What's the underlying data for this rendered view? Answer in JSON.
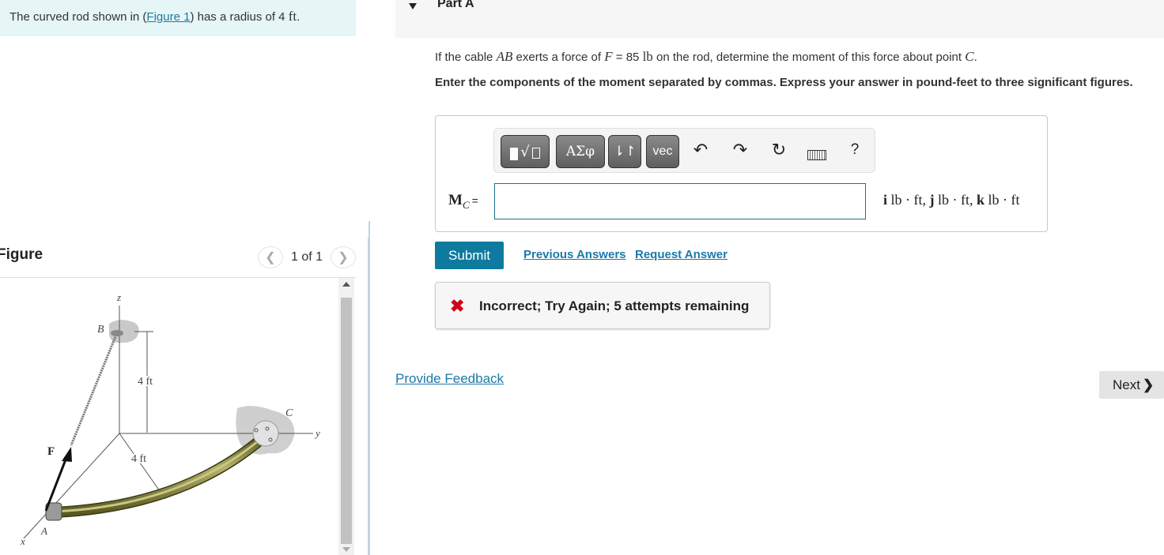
{
  "intro": {
    "text_before": "The curved rod shown in (",
    "figure_link": "Figure 1",
    "text_after": ") has a radius of 4 ",
    "unit": "ft",
    "period": "."
  },
  "figure_panel": {
    "title": "Figure",
    "pager": {
      "prev_icon": "chevron-left-icon",
      "text": "1 of 1",
      "next_icon": "chevron-right-icon"
    },
    "diagram_labels": {
      "z_axis": "z",
      "y_axis": "y",
      "x_axis": "x",
      "point_b": "B",
      "point_c": "C",
      "point_a": "A",
      "force": "F",
      "height_dim": "4 ft",
      "radius_dim": "4 ft"
    }
  },
  "part": {
    "title": "Part A",
    "question": {
      "t1": "If the cable ",
      "m1": "AB",
      "t2": " exerts a force of ",
      "m2": "F",
      "t3": " = 85 ",
      "m3": "lb",
      "t4": " on the rod, determine the moment of this force about point ",
      "m4": "C",
      "t5": "."
    },
    "instructions": "Enter the components of the moment separated by commas. Express your answer in pound-feet to three significant figures.",
    "toolbar": {
      "templates_icon": "templates-icon",
      "greek_label": "ΑΣφ",
      "arrows_label": "⇂↾",
      "vec_label": "vec",
      "undo_icon": "undo-icon",
      "redo_icon": "redo-icon",
      "reset_icon": "reset-icon",
      "keyboard_icon": "keyboard-icon",
      "help_label": "?"
    },
    "answer": {
      "label_main": "M",
      "label_sub": "C",
      "equals": "=",
      "value": "",
      "units": {
        "i": "i",
        "i_unit": " lb · ft, ",
        "j": "j",
        "j_unit": " lb · ft, ",
        "k": "k",
        "k_unit": " lb · ft"
      }
    },
    "submit_label": "Submit",
    "previous_answers_label": "Previous Answers",
    "request_answer_label": "Request Answer",
    "feedback": {
      "status": "incorrect",
      "text": "Incorrect; Try Again; 5 attempts remaining",
      "color": "#d0021b"
    }
  },
  "provide_feedback_label": "Provide Feedback",
  "next_label": "Next",
  "colors": {
    "accent": "#0e7b9e",
    "link": "#1a7aa8",
    "intro_bg": "#e6f5f6",
    "rod": "#8c8a3e"
  }
}
